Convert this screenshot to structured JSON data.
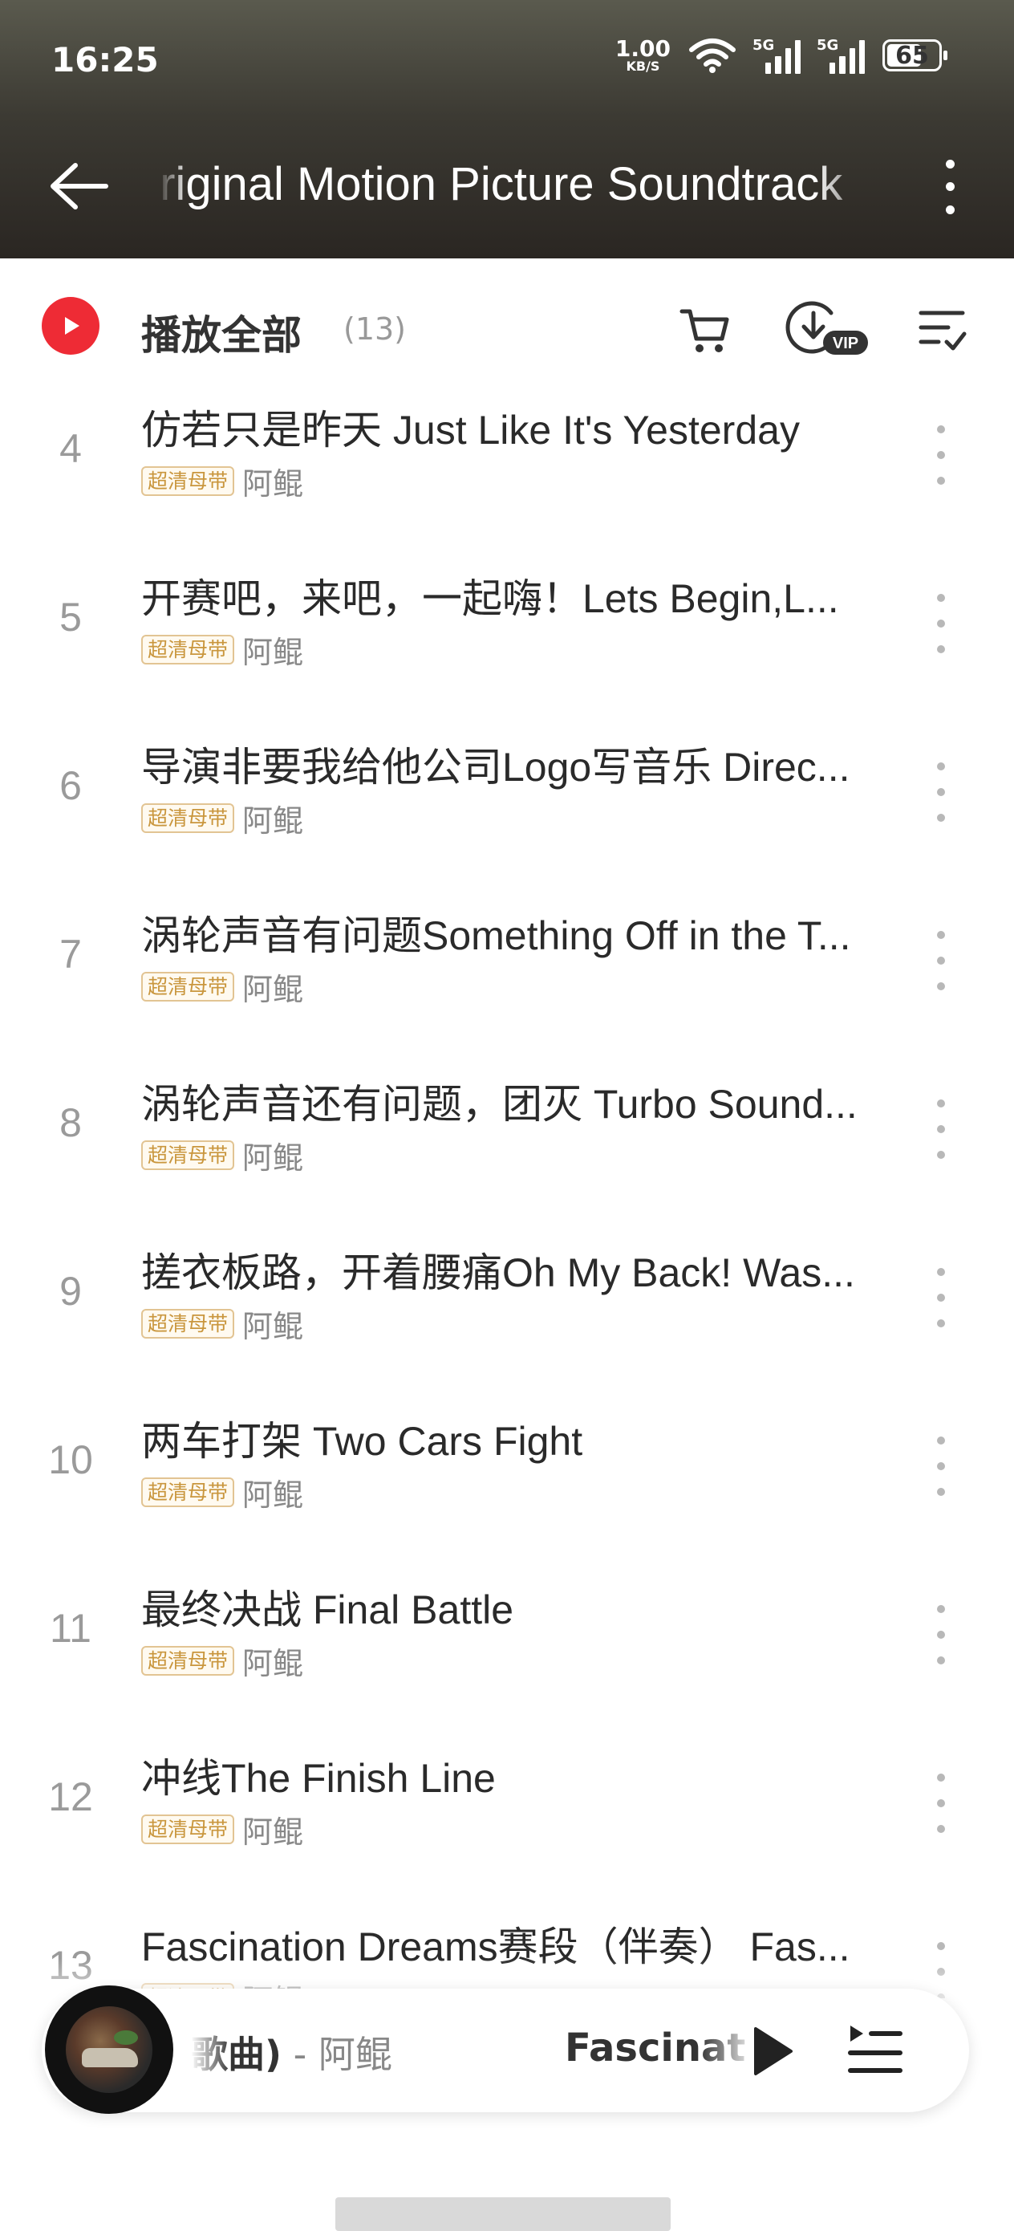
{
  "status_bar": {
    "time": "16:25",
    "net_speed_value": "1.00",
    "net_speed_unit": "KB/S",
    "sim1_label": "5G",
    "sim2_label": "5G",
    "battery": "65"
  },
  "header": {
    "title": "Original Motion Picture Soundtrack",
    "background": "#3a3630"
  },
  "play_all": {
    "label": "播放全部",
    "count": "(13)",
    "accent": "#ee2b35",
    "download_badge": "VIP"
  },
  "tracks": [
    {
      "number": "4",
      "title": "仿若只是昨天 Just Like It's Yesterday",
      "badge": "超清母带",
      "artist": "阿鲲"
    },
    {
      "number": "5",
      "title": "开赛吧，来吧，一起嗨！Lets Begin,L...",
      "badge": "超清母带",
      "artist": "阿鲲"
    },
    {
      "number": "6",
      "title": "导演非要我给他公司Logo写音乐 Direc...",
      "badge": "超清母带",
      "artist": "阿鲲"
    },
    {
      "number": "7",
      "title": "涡轮声音有问题Something Off in the T...",
      "badge": "超清母带",
      "artist": "阿鲲"
    },
    {
      "number": "8",
      "title": "涡轮声音还有问题，团灭 Turbo Sound...",
      "badge": "超清母带",
      "artist": "阿鲲"
    },
    {
      "number": "9",
      "title": "搓衣板路，开着腰痛Oh My Back! Was...",
      "badge": "超清母带",
      "artist": "阿鲲"
    },
    {
      "number": "10",
      "title": "两车打架 Two Cars Fight",
      "badge": "超清母带",
      "artist": "阿鲲"
    },
    {
      "number": "11",
      "title": "最终决战 Final Battle",
      "badge": "超清母带",
      "artist": "阿鲲"
    },
    {
      "number": "12",
      "title": "冲线The Finish Line",
      "badge": "超清母带",
      "artist": "阿鲲"
    },
    {
      "number": "13",
      "title": "Fascination Dreams赛段（伴奏） Fas...",
      "badge": "超清母带",
      "artist": "阿鲲"
    }
  ],
  "mini_player": {
    "song_fragment": "歌曲)",
    "separator": " - ",
    "artist": "阿鲲",
    "next_fragment": "Fascinat"
  },
  "icons": {
    "back": "arrow-left-icon",
    "more": "more-vertical-icon",
    "play": "play-icon",
    "cart": "cart-icon",
    "download": "download-vip-icon",
    "sort": "sort-list-icon",
    "playlist": "playlist-icon"
  }
}
